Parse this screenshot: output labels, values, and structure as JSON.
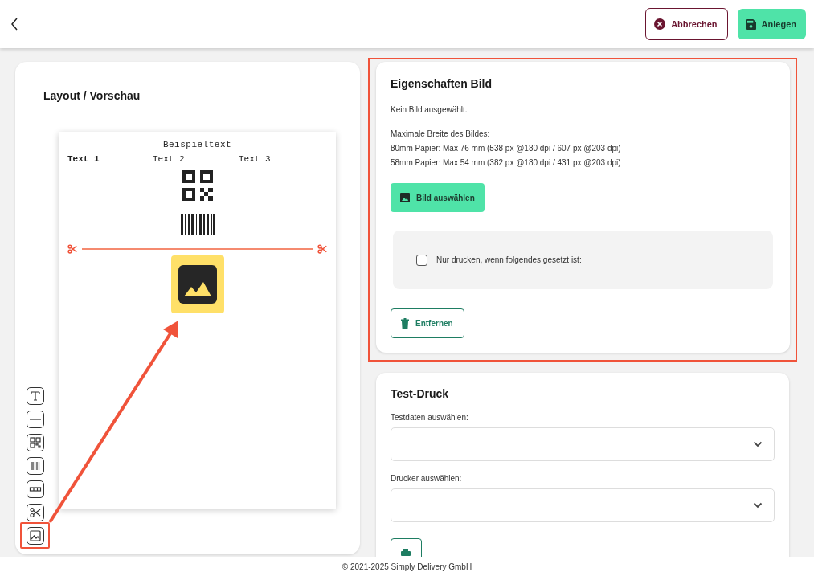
{
  "header": {
    "buttons": [
      {
        "kind": "cancel",
        "label": "Abbrechen"
      },
      {
        "kind": "save",
        "label": "Anlegen"
      }
    ]
  },
  "preview": {
    "title": "Layout / Vorschau",
    "elements": [
      {
        "kind": "heading",
        "text": "Beispieltext"
      },
      {
        "kind": "columns",
        "columns": [
          {
            "text": "Text 1",
            "bold": true
          },
          {
            "text": "Text 2",
            "bold": false
          },
          {
            "text": "Text 3",
            "bold": false
          }
        ]
      },
      {
        "kind": "qr"
      },
      {
        "kind": "barcode"
      },
      {
        "kind": "cut"
      },
      {
        "kind": "image",
        "selected": true
      }
    ],
    "tools": [
      {
        "kind": "text",
        "highlighted": false
      },
      {
        "kind": "line",
        "highlighted": false
      },
      {
        "kind": "qr",
        "highlighted": false
      },
      {
        "kind": "barcode",
        "highlighted": false
      },
      {
        "kind": "columns",
        "highlighted": false
      },
      {
        "kind": "cut",
        "highlighted": false
      },
      {
        "kind": "image",
        "highlighted": true
      }
    ]
  },
  "image_properties": {
    "title": "Eigenschaften Bild",
    "highlighted": true,
    "status": "Kein Bild ausgewählt.",
    "width_info": [
      "Maximale Breite des Bildes:",
      "80mm Papier: Max 76 mm (538 px @180 dpi / 607 px @203 dpi)",
      "58mm Papier: Max 54 mm (382 px @180 dpi / 431 px @203 dpi)"
    ],
    "select_button": "Bild auswählen",
    "condition": {
      "label": "Nur drucken, wenn folgendes gesetzt ist:",
      "checked": false
    },
    "remove_button": "Entfernen"
  },
  "test_print": {
    "title": "Test-Druck",
    "fields": [
      {
        "label": "Testdaten auswählen:"
      },
      {
        "label": "Drucker auswählen:"
      }
    ]
  },
  "footer": "© 2021-2025 Simply Delivery GmbH"
}
